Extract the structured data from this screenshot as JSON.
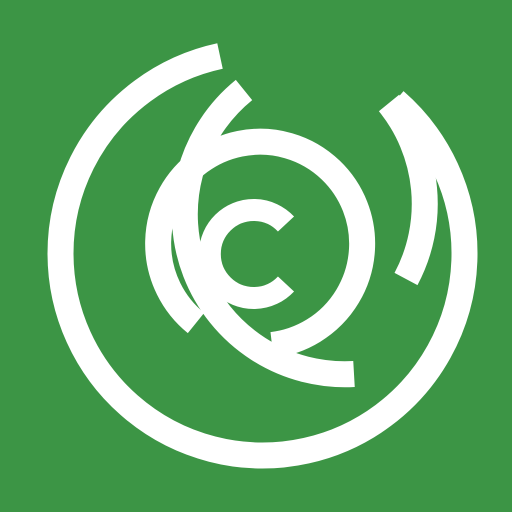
{
  "icon": {
    "name": "concentric-c-spiral-logo",
    "background_color": "#3C9545",
    "foreground_color": "#FFFFFF"
  }
}
